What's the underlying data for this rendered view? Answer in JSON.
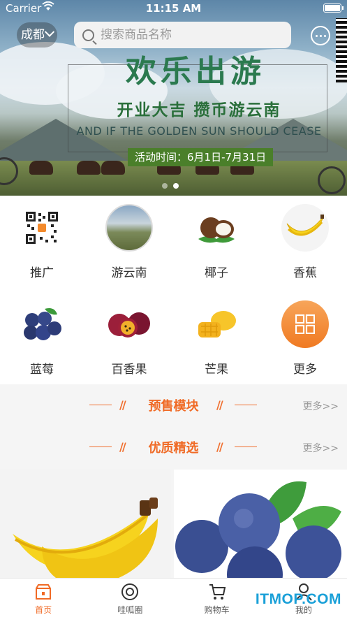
{
  "status_bar": {
    "carrier": "Carrier",
    "time": "11:15 AM"
  },
  "header": {
    "city": "成都",
    "search_placeholder": "搜索商品名称"
  },
  "banner": {
    "headline": "欢乐出游",
    "subtitle": "开业大吉 攒币游云南",
    "english": "AND IF THE GOLDEN SUN SHOULD CEASE",
    "date_text": "活动时间：6月1日-7月31日",
    "slide_count": 2,
    "active_slide": 2
  },
  "categories": [
    {
      "label": "推广",
      "icon": "qr-code-icon"
    },
    {
      "label": "游云南",
      "icon": "landscape-icon"
    },
    {
      "label": "椰子",
      "icon": "coconut-icon"
    },
    {
      "label": "香蕉",
      "icon": "banana-icon"
    },
    {
      "label": "蓝莓",
      "icon": "blueberry-icon"
    },
    {
      "label": "百香果",
      "icon": "passion-fruit-icon"
    },
    {
      "label": "芒果",
      "icon": "mango-icon"
    },
    {
      "label": "更多",
      "icon": "grid-icon"
    }
  ],
  "sections": [
    {
      "title": "预售模块",
      "more": "更多>>"
    },
    {
      "title": "优质精选",
      "more": "更多>>"
    }
  ],
  "tabbar": [
    {
      "label": "首页",
      "icon": "shop-icon",
      "active": true
    },
    {
      "label": "哇呱圈",
      "icon": "circle-icon",
      "active": false
    },
    {
      "label": "购物车",
      "icon": "cart-icon",
      "active": false
    },
    {
      "label": "我的",
      "icon": "user-icon",
      "active": false
    }
  ],
  "watermark": "ITMOP.COM",
  "colors": {
    "accent": "#f06a25",
    "more_bg": "#f38a2c",
    "banner_green": "#4a7f2a"
  }
}
